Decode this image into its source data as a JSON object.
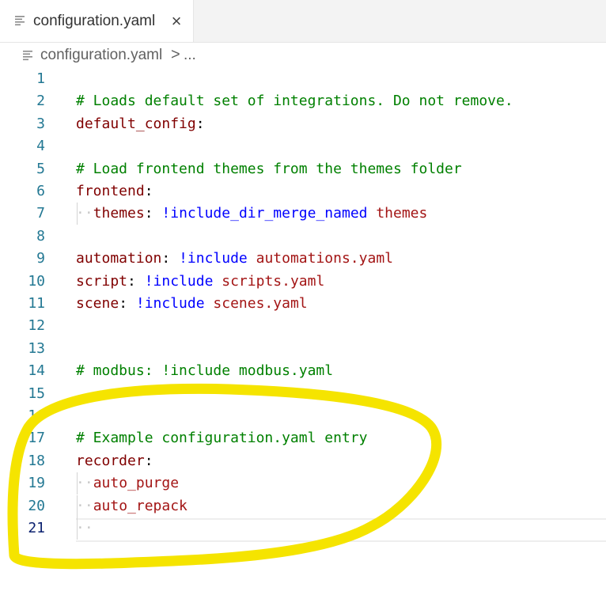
{
  "tab": {
    "title": "configuration.yaml",
    "icon": "file-lines-icon",
    "close": "×"
  },
  "breadcrumb": {
    "file": "configuration.yaml",
    "separator": ">",
    "more": "..."
  },
  "colors": {
    "comment": "#008000",
    "key": "#800000",
    "tag": "#0000ff",
    "value": "#a31515",
    "line_number": "#237893",
    "annotation": "#f5e400"
  },
  "editor": {
    "active_line": "21",
    "lines": [
      {
        "n": "1"
      },
      {
        "n": "2",
        "comment": "# Loads default set of integrations. Do not remove."
      },
      {
        "n": "3",
        "key": "default_config",
        "colon": ":"
      },
      {
        "n": "4"
      },
      {
        "n": "5",
        "comment": "# Load frontend themes from the themes folder"
      },
      {
        "n": "6",
        "key": "frontend",
        "colon": ":"
      },
      {
        "n": "7",
        "indent": "··",
        "key": "themes",
        "colon": ": ",
        "tag": "!include_dir_merge_named",
        "value": " themes"
      },
      {
        "n": "8"
      },
      {
        "n": "9",
        "key": "automation",
        "colon": ": ",
        "tag": "!include",
        "value": " automations.yaml"
      },
      {
        "n": "10",
        "key": "script",
        "colon": ": ",
        "tag": "!include",
        "value": " scripts.yaml"
      },
      {
        "n": "11",
        "key": "scene",
        "colon": ": ",
        "tag": "!include",
        "value": " scenes.yaml"
      },
      {
        "n": "12"
      },
      {
        "n": "13"
      },
      {
        "n": "14",
        "comment": "# modbus: !include modbus.yaml"
      },
      {
        "n": "15"
      },
      {
        "n": "16"
      },
      {
        "n": "17",
        "comment": "# Example configuration.yaml entry"
      },
      {
        "n": "18",
        "key": "recorder",
        "colon": ":"
      },
      {
        "n": "19",
        "indent": "··",
        "value": "auto_purge"
      },
      {
        "n": "20",
        "indent": "··",
        "value": "auto_repack"
      },
      {
        "n": "21",
        "indent": "··"
      }
    ]
  }
}
